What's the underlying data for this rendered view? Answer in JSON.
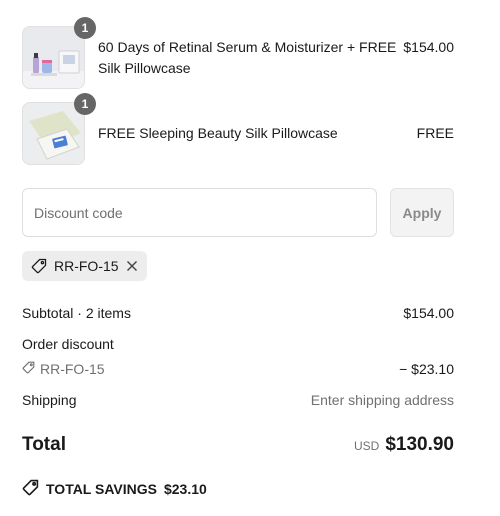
{
  "line_items": [
    {
      "name_line1": "60 Days of Retinal Serum & Moisturizer + FREE",
      "name_line2": "Silk Pillowcase",
      "price": "$154.00",
      "quantity": "1",
      "image_icon": "serum-product-image"
    },
    {
      "name_line1": "FREE Sleeping Beauty Silk Pillowcase",
      "price": "FREE",
      "quantity": "1",
      "image_icon": "pillowcase-product-image"
    }
  ],
  "discount": {
    "placeholder": "Discount code",
    "apply_label": "Apply",
    "applied_code": "RR-FO-15"
  },
  "summary": {
    "subtotal_label": "Subtotal · 2 items",
    "subtotal_value": "$154.00",
    "order_discount_label": "Order discount",
    "discount_code": "RR-FO-15",
    "discount_value": "− $23.10",
    "shipping_label": "Shipping",
    "shipping_value": "Enter shipping address",
    "total_label": "Total",
    "currency": "USD",
    "total_value": "$130.90",
    "savings_label": "TOTAL SAVINGS",
    "savings_value": "$23.10"
  },
  "colors": {
    "badge": "#666666",
    "muted_text": "#707070",
    "chip_bg": "#ededed"
  }
}
